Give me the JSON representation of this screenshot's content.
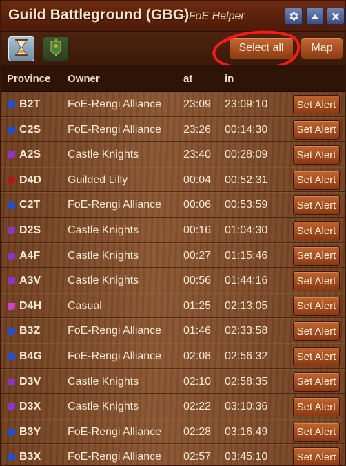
{
  "header": {
    "title": "Guild Battleground (GBG)",
    "subtitle": "- FoE Helper",
    "settings_icon": "gear-icon",
    "minimize_icon": "chevron-up-icon",
    "close_icon": "close-icon"
  },
  "toolbar": {
    "tab_active_icon": "hourglass-icon",
    "tab_inactive_icon": "banner-icon",
    "select_all_label": "Select all",
    "map_label": "Map"
  },
  "table": {
    "headers": {
      "province": "Province",
      "owner": "Owner",
      "at": "at",
      "in": "in"
    },
    "alert_label": "Set Alert",
    "rows": [
      {
        "province": "B2T",
        "owner": "FoE-Rengi Alliance",
        "at": "23:09",
        "in": "23:09:10",
        "color": "#1d4fd8"
      },
      {
        "province": "C2S",
        "owner": "FoE-Rengi Alliance",
        "at": "23:26",
        "in": "00:14:30",
        "color": "#1d4fd8"
      },
      {
        "province": "A2S",
        "owner": "Castle Knights",
        "at": "23:40",
        "in": "00:28:09",
        "color": "#8e32c8"
      },
      {
        "province": "D4D",
        "owner": "Guilded Lilly",
        "at": "00:04",
        "in": "00:52:31",
        "color": "#b01818"
      },
      {
        "province": "C2T",
        "owner": "FoE-Rengi Alliance",
        "at": "00:06",
        "in": "00:53:59",
        "color": "#1d4fd8"
      },
      {
        "province": "D2S",
        "owner": "Castle Knights",
        "at": "00:16",
        "in": "01:04:30",
        "color": "#8e32c8"
      },
      {
        "province": "A4F",
        "owner": "Castle Knights",
        "at": "00:27",
        "in": "01:15:46",
        "color": "#8e32c8"
      },
      {
        "province": "A3V",
        "owner": "Castle Knights",
        "at": "00:56",
        "in": "01:44:16",
        "color": "#8e32c8"
      },
      {
        "province": "D4H",
        "owner": "Casual",
        "at": "01:25",
        "in": "02:13:05",
        "color": "#d040c8"
      },
      {
        "province": "B3Z",
        "owner": "FoE-Rengi Alliance",
        "at": "01:46",
        "in": "02:33:58",
        "color": "#1d4fd8"
      },
      {
        "province": "B4G",
        "owner": "FoE-Rengi Alliance",
        "at": "02:08",
        "in": "02:56:32",
        "color": "#1d4fd8"
      },
      {
        "province": "D3V",
        "owner": "Castle Knights",
        "at": "02:10",
        "in": "02:58:35",
        "color": "#8e32c8"
      },
      {
        "province": "D3X",
        "owner": "Castle Knights",
        "at": "02:22",
        "in": "03:10:36",
        "color": "#8e32c8"
      },
      {
        "province": "B3Y",
        "owner": "FoE-Rengi Alliance",
        "at": "02:28",
        "in": "03:16:49",
        "color": "#1d4fd8"
      },
      {
        "province": "B3X",
        "owner": "FoE-Rengi Alliance",
        "at": "02:57",
        "in": "03:45:10",
        "color": "#1d4fd8"
      }
    ]
  }
}
